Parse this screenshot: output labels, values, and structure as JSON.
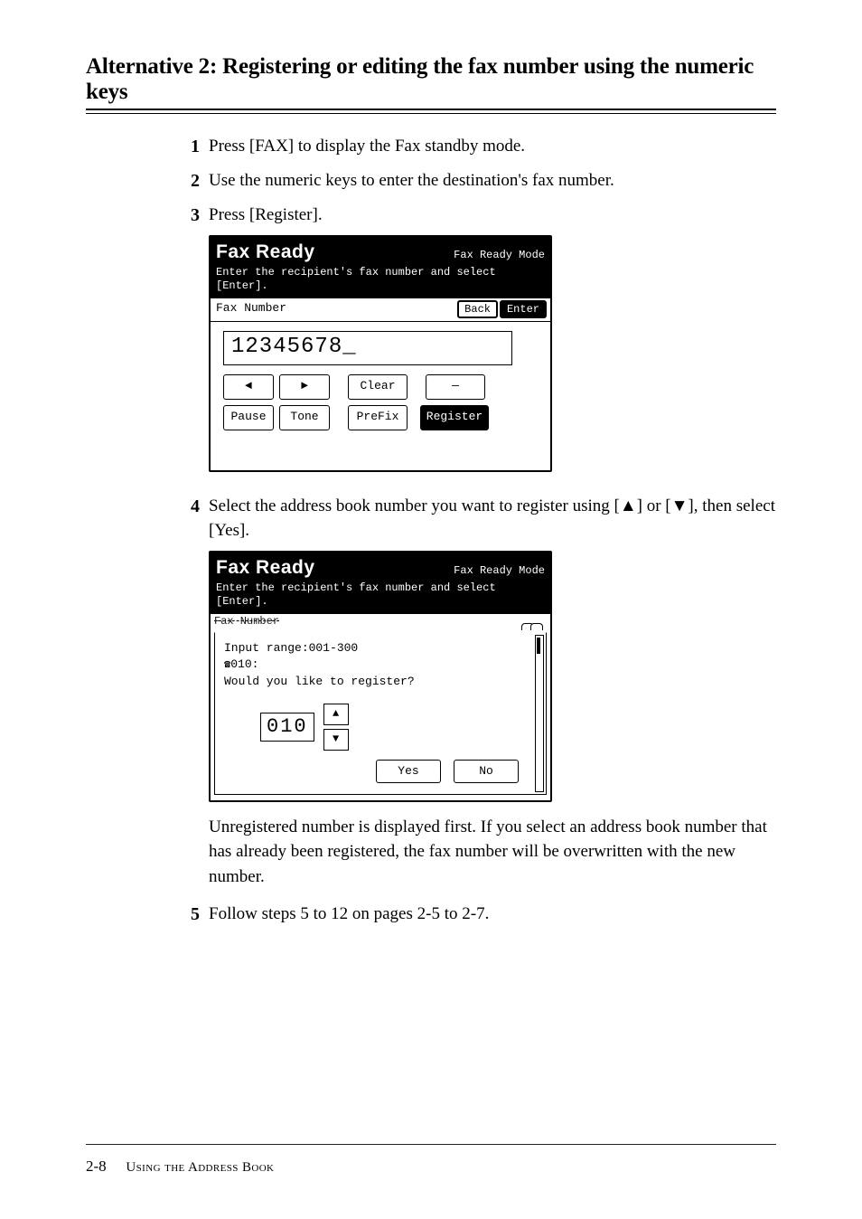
{
  "section_title": "Alternative 2: Registering or editing the fax number using the numeric keys",
  "steps": {
    "s1": {
      "num": "1",
      "text": "Press [FAX] to display the Fax standby mode."
    },
    "s2": {
      "num": "2",
      "text": "Use the numeric keys to enter the destination's fax number."
    },
    "s3": {
      "num": "3",
      "text": "Press [Register]."
    },
    "s4": {
      "num": "4",
      "text": "Select the address book number you want to register using [▲] or [▼], then select [Yes]."
    },
    "s4_note": "Unregistered number is displayed first. If you select an address book number that has already been registered, the fax number will be overwritten with the new number.",
    "s5": {
      "num": "5",
      "text": "Follow steps 5 to 12 on pages 2-5 to 2-7."
    }
  },
  "lcd1": {
    "ready": "Fax Ready",
    "mode": "Fax Ready Mode",
    "prompt": "Enter the recipient's fax number and select [Enter].",
    "bar_label": "Fax Number",
    "btn_back": "Back",
    "btn_enter": "Enter",
    "input_value": "12345678_",
    "btn_left": "◄",
    "btn_right": "►",
    "btn_clear": "Clear",
    "btn_dash": "—",
    "btn_pause": "Pause",
    "btn_tone": "Tone",
    "btn_prefix": "PreFix",
    "btn_register": "Register"
  },
  "lcd2": {
    "ready": "Fax Ready",
    "mode": "Fax Ready Mode",
    "prompt": "Enter the recipient's fax number and select [Enter].",
    "bar_frag_left": "Fax Number",
    "dlg_range": "Input range:001-300",
    "dlg_slot_prefix": "☎",
    "dlg_slot": "010:",
    "dlg_question": "Would you like to register?",
    "dlg_value": "010",
    "btn_up": "▲",
    "btn_down": "▼",
    "btn_yes": "Yes",
    "btn_no": "No"
  },
  "footer": {
    "page_num": "2-8",
    "chapter": "Using the Address Book"
  }
}
